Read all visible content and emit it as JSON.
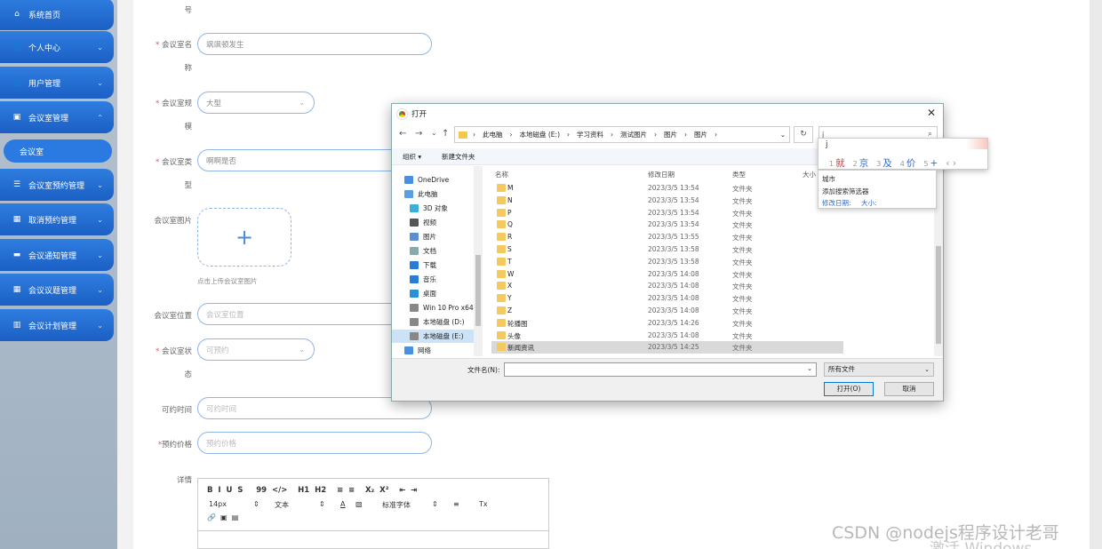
{
  "sidebar": {
    "items": [
      {
        "label": "系统首页",
        "icon": "home-icon",
        "glyph": "⌂",
        "chev": ""
      },
      {
        "label": "个人中心",
        "icon": "user-icon",
        "glyph": "👤",
        "chev": "⌄"
      },
      {
        "label": "用户管理",
        "icon": "user-icon",
        "glyph": "👤",
        "chev": "⌄"
      },
      {
        "label": "会议室管理",
        "icon": "building-icon",
        "glyph": "▣",
        "chev": "⌃"
      },
      {
        "label": "会议室预约管理",
        "icon": "list-icon",
        "glyph": "☰",
        "chev": "⌄"
      },
      {
        "label": "取消预约管理",
        "icon": "grid-icon",
        "glyph": "▦",
        "chev": "⌄"
      },
      {
        "label": "会议通知管理",
        "icon": "monitor-icon",
        "glyph": "▬",
        "chev": "⌄"
      },
      {
        "label": "会议议题管理",
        "icon": "grid-icon",
        "glyph": "▦",
        "chev": "⌄"
      },
      {
        "label": "会议计划管理",
        "icon": "bar-chart-icon",
        "glyph": "▥",
        "chev": "⌄"
      }
    ],
    "sub_item": "会议室"
  },
  "form": {
    "top_label_tail": "号",
    "name_label": "会议室名",
    "name_label_cont": "称",
    "name_value": "飒飒顿发生",
    "size_label": "会议室规",
    "size_label_cont": "模",
    "size_value": "大型",
    "type_label": "会议室类",
    "type_label_cont": "型",
    "type_value": "啊啊是否",
    "image_label": "会议室图片",
    "upload_plus": "+",
    "upload_hint": "点击上传会议室图片",
    "location_label": "会议室位置",
    "location_placeholder": "会议室位置",
    "status_label": "会议室状",
    "status_label_cont": "态",
    "status_placeholder": "可预约",
    "time_label": "可约时间",
    "time_placeholder": "可约时间",
    "price_label": "预约价格",
    "price_placeholder": "预约价格",
    "detail_label": "详情",
    "req": "*"
  },
  "editor": {
    "row1": "B  I  U  S     99  </>    H1  H2    ≡  ≡    X₂  X²    ⇤  ⇥",
    "fontsize": "14px",
    "fontsize_arrow": "⇕",
    "text": "文本",
    "text_arrow": "⇕",
    "color": "A",
    "bg": "▧",
    "fontname": "标准字体",
    "fontname_arrow": "⇕",
    "align": "≡",
    "clear": "Tx",
    "row3": "🔗  ▣  ▤"
  },
  "dialog": {
    "title": "打开",
    "close": "✕",
    "nav": [
      "←",
      "→",
      "⌄",
      "↑"
    ],
    "path": [
      "此电脑",
      "›",
      "本地磁盘 (E:)",
      "›",
      "学习资料",
      "›",
      "测试图片",
      "›",
      "图片",
      "›",
      "图片",
      "›"
    ],
    "path_start": "›",
    "path_dropdown": "⌄",
    "refresh": "↻",
    "search_value": "j",
    "search_icon": "⌕",
    "cmd_organize": "组织 ▾",
    "cmd_newfolder": "新建文件夹",
    "tree": [
      {
        "label": "OneDrive",
        "color": "#4a90e2"
      },
      {
        "label": "此电脑",
        "color": "#5aa0e0"
      },
      {
        "label": "3D 对象",
        "color": "#3ab0d8"
      },
      {
        "label": "视频",
        "color": "#555"
      },
      {
        "label": "图片",
        "color": "#5b8fcf"
      },
      {
        "label": "文档",
        "color": "#8aa"
      },
      {
        "label": "下载",
        "color": "#2a7ad6"
      },
      {
        "label": "音乐",
        "color": "#2a7ad6"
      },
      {
        "label": "桌面",
        "color": "#2a90d6"
      },
      {
        "label": "Win 10 Pro x64",
        "color": "#888"
      },
      {
        "label": "本地磁盘 (D:)",
        "color": "#888"
      },
      {
        "label": "本地磁盘 (E:)",
        "color": "#888"
      },
      {
        "label": "网络",
        "color": "#4a90e2"
      }
    ],
    "columns": {
      "name": "名称",
      "date": "修改日期",
      "type": "类型",
      "size": "大小"
    },
    "files": [
      {
        "name": "M",
        "date": "2023/3/5 13:54",
        "type": "文件夹"
      },
      {
        "name": "N",
        "date": "2023/3/5 13:54",
        "type": "文件夹"
      },
      {
        "name": "P",
        "date": "2023/3/5 13:54",
        "type": "文件夹"
      },
      {
        "name": "Q",
        "date": "2023/3/5 13:54",
        "type": "文件夹"
      },
      {
        "name": "R",
        "date": "2023/3/5 13:55",
        "type": "文件夹"
      },
      {
        "name": "S",
        "date": "2023/3/5 13:58",
        "type": "文件夹"
      },
      {
        "name": "T",
        "date": "2023/3/5 13:58",
        "type": "文件夹"
      },
      {
        "name": "W",
        "date": "2023/3/5 14:08",
        "type": "文件夹"
      },
      {
        "name": "X",
        "date": "2023/3/5 14:08",
        "type": "文件夹"
      },
      {
        "name": "Y",
        "date": "2023/3/5 14:08",
        "type": "文件夹"
      },
      {
        "name": "Z",
        "date": "2023/3/5 14:08",
        "type": "文件夹"
      },
      {
        "name": "轮播图",
        "date": "2023/3/5 14:26",
        "type": "文件夹"
      },
      {
        "name": "头像",
        "date": "2023/3/5 14:08",
        "type": "文件夹"
      },
      {
        "name": "新闻资讯",
        "date": "2023/3/5 14:25",
        "type": "文件夹"
      }
    ],
    "filename_label": "文件名(N):",
    "filename_value": "",
    "filename_arrow": "⌄",
    "filetype": "所有文件",
    "filetype_arrow": "⌄",
    "open_btn": "打开(O)",
    "cancel_btn": "取消"
  },
  "ime": {
    "pinyin": "j",
    "cands": [
      [
        "1",
        "就"
      ],
      [
        "2",
        "京"
      ],
      [
        "3",
        "及"
      ],
      [
        "4",
        "价"
      ],
      [
        "5",
        "+"
      ]
    ],
    "nav": "‹  ›"
  },
  "suggest": {
    "city": "城市",
    "add_filter": "添加搜索筛选器",
    "mod_date": "修改日期:",
    "size": "大小:"
  },
  "watermark": {
    "text": "CSDN @nodejs程序设计老哥",
    "activate": "激活 Windows"
  },
  "colors": {
    "accent": "#1b5fc4",
    "sidebar": "#a9b8c8"
  }
}
